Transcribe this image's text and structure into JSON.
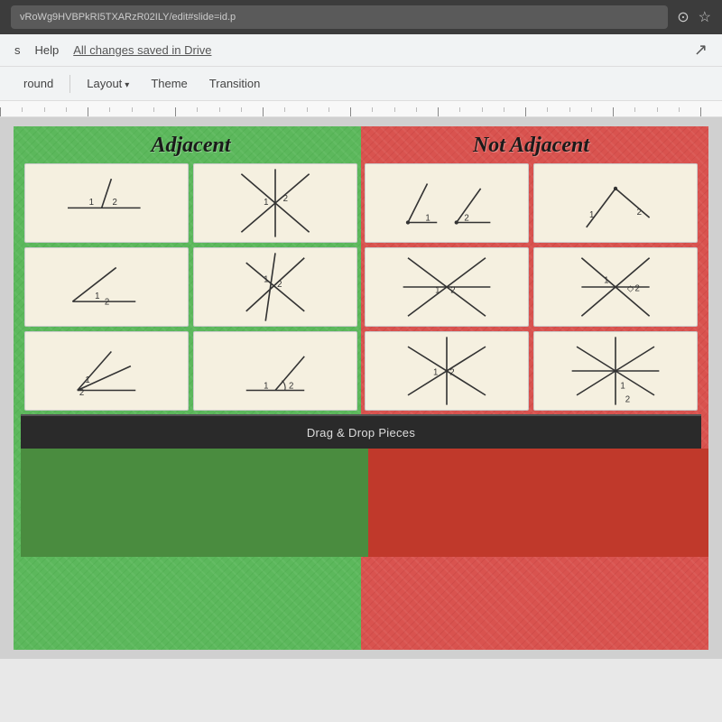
{
  "browser": {
    "url": "vRoWg9HVBPkRI5TXARzR02ILY/edit#slide=id.p",
    "tab_icon": "⊙",
    "star_icon": "☆"
  },
  "menu": {
    "items": [
      "s",
      "Help"
    ],
    "save_status": "All changes saved in Drive",
    "corner_icon": "↗"
  },
  "toolbar": {
    "background_label": "round",
    "layout_label": "Layout",
    "theme_label": "Theme",
    "transition_label": "Transition"
  },
  "slide": {
    "adjacent_title": "Adjacent",
    "not_adjacent_title": "Not Adjacent",
    "drag_drop_label": "Drag & Drop Pieces"
  }
}
